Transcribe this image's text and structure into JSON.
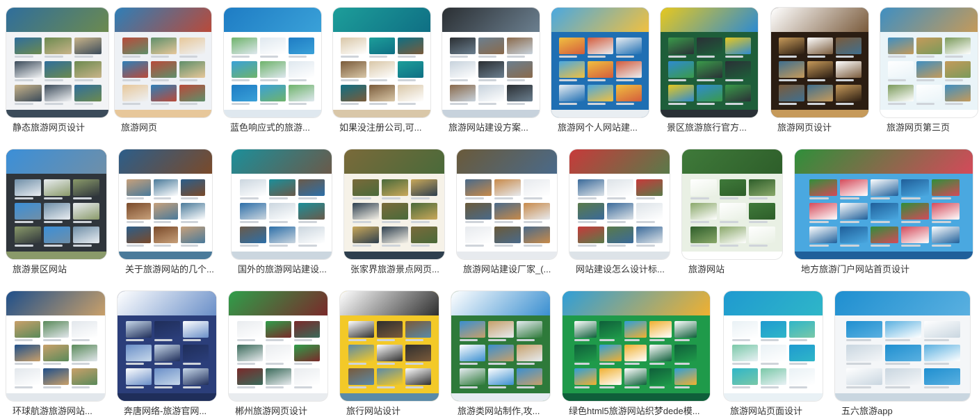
{
  "results": [
    {
      "title": "静态旅游网页设计",
      "palette": [
        "#f2f3f5",
        "#2f6e9c",
        "#6c8a4f",
        "#c9b48a",
        "#3b4b5a"
      ]
    },
    {
      "title": "旅游网页",
      "palette": [
        "#eef1f5",
        "#2e7fb8",
        "#b94a3a",
        "#5f8f6a",
        "#e7c79a"
      ]
    },
    {
      "title": "蓝色响应式的旅游...",
      "palette": [
        "#ffffff",
        "#1e7cc4",
        "#3aa1d8",
        "#6fb36b",
        "#dfe8ef"
      ]
    },
    {
      "title": "如果没注册公司,可...",
      "palette": [
        "#ffffff",
        "#1d9e9a",
        "#0f6f84",
        "#7a5b3a",
        "#d9c7a8"
      ]
    },
    {
      "title": "旅游网站建设方案...",
      "palette": [
        "#ffffff",
        "#2b2f33",
        "#6b7f8f",
        "#8a6a4b",
        "#c7d2dc"
      ]
    },
    {
      "title": "旅游网个人网站建...",
      "palette": [
        "#1f6fb3",
        "#4aa8e0",
        "#f0c040",
        "#d45c3c",
        "#e9eef2"
      ]
    },
    {
      "title": "景区旅游旅行官方...",
      "palette": [
        "#1e5e3a",
        "#e7c81f",
        "#2e8bd0",
        "#3a9a4a",
        "#2a3036"
      ]
    },
    {
      "title": "旅游网页设计",
      "palette": [
        "#2b1d12",
        "#ffffff",
        "#7a5b3c",
        "#3f6f8f",
        "#c69a5a"
      ]
    },
    {
      "title": "旅游网页第三页",
      "palette": [
        "#eaf4f8",
        "#3f8fc2",
        "#c49a5a",
        "#7a9a5a",
        "#ffffff"
      ]
    },
    {
      "title": "旅游景区网站",
      "palette": [
        "#2f353b",
        "#3b8fd8",
        "#6f8fa8",
        "#e9edf1",
        "#8a9a6a"
      ]
    },
    {
      "title": "关于旅游网站的几个...",
      "palette": [
        "#ffffff",
        "#2c5e8a",
        "#7a4a2a",
        "#c7a07a",
        "#4a7a9a"
      ]
    },
    {
      "title": "国外的旅游网站建设...",
      "palette": [
        "#ffffff",
        "#1c8f9a",
        "#6a5a4a",
        "#2d6fa8",
        "#cbd6df"
      ]
    },
    {
      "title": "张家界旅游景点网页...",
      "palette": [
        "#f6f2e8",
        "#7a6a3a",
        "#4a6a3a",
        "#c9a85a",
        "#2e3f4e"
      ]
    },
    {
      "title": "旅游网站建设厂家_(...",
      "palette": [
        "#ffffff",
        "#6a5a3a",
        "#4a6a8a",
        "#c78a4a",
        "#e7eaee"
      ]
    },
    {
      "title": "网站建设怎么设计标...",
      "palette": [
        "#ffffff",
        "#c73a3a",
        "#5a7a4a",
        "#3a6a9a",
        "#dde3e8"
      ]
    },
    {
      "title": "旅游网站",
      "palette": [
        "#e9f0e4",
        "#3f7a3a",
        "#2e5e2a",
        "#8aa86a",
        "#ffffff"
      ]
    },
    {
      "title": "地方旅游门户网站首页设计",
      "palette": [
        "#4aa8e0",
        "#2f8f3a",
        "#d44a5a",
        "#ffffff",
        "#1f5f9a"
      ]
    },
    {
      "title": "环球航游旅游网站...",
      "palette": [
        "#ffffff",
        "#1f4f8a",
        "#c9a06a",
        "#5a8a5a",
        "#e2e7ec"
      ]
    },
    {
      "title": "奔唐网络-旅游官网...",
      "palette": [
        "#2b3e7a",
        "#ffffff",
        "#6a8fc8",
        "#c7d8ea",
        "#1f2e5a"
      ]
    },
    {
      "title": "郴州旅游网页设计",
      "palette": [
        "#ffffff",
        "#2f9e4a",
        "#7a2a2a",
        "#3a6a5a",
        "#e9ecef"
      ]
    },
    {
      "title": "旅行网站设计",
      "palette": [
        "#f3c928",
        "#ffffff",
        "#2e2e2e",
        "#7a5a3a",
        "#5a8aa8"
      ]
    },
    {
      "title": "旅游类网站制作,攻...",
      "palette": [
        "#2e7a3a",
        "#ffffff",
        "#3a8fd0",
        "#c7a06a",
        "#e6ecf1"
      ]
    },
    {
      "title": "绿色html5旅游网站织梦dede模...",
      "palette": [
        "#1f9a4a",
        "#2f9ed8",
        "#f0b030",
        "#ffffff",
        "#0f5f3a"
      ]
    },
    {
      "title": "旅游网站页面设计",
      "palette": [
        "#ffffff",
        "#1f9ad0",
        "#2fb6c8",
        "#7ac8a8",
        "#e9f1f5"
      ]
    },
    {
      "title": "五六旅游app",
      "palette": [
        "#f4f6f8",
        "#1f8fd0",
        "#5ab0e0",
        "#ffffff",
        "#c9d6e0"
      ]
    }
  ]
}
